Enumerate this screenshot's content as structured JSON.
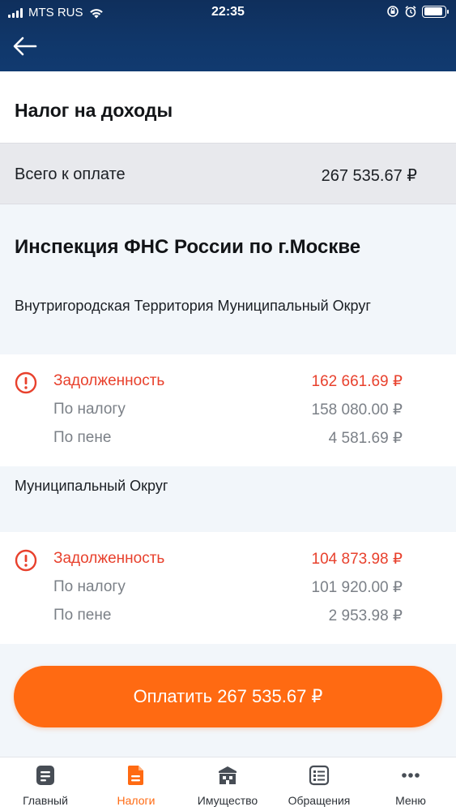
{
  "status_bar": {
    "carrier": "MTS RUS",
    "time": "22:35"
  },
  "header": {
    "back_icon": "arrow-left-icon"
  },
  "page": {
    "title": "Налог на доходы"
  },
  "total": {
    "label": "Всего к оплате",
    "value": "267 535.67 ₽"
  },
  "inspection": {
    "name": "Инспекция ФНС России по г.Москве",
    "district": "Внутригородская Территория Муниципальный Округ"
  },
  "debts": [
    {
      "title": "Задолженность",
      "amount": "162 661.69 ₽",
      "tax_label": "По налогу",
      "tax_amount": "158 080.00 ₽",
      "penalty_label": "По пене",
      "penalty_amount": "4 581.69 ₽"
    },
    {
      "title": "Задолженность",
      "amount": "104 873.98 ₽",
      "tax_label": "По налогу",
      "tax_amount": "101 920.00 ₽",
      "penalty_label": "По пене",
      "penalty_amount": "2 953.98 ₽"
    }
  ],
  "municipality": {
    "label": "Муниципальный Округ"
  },
  "pay_button": {
    "label": "Оплатить 267 535.67 ₽"
  },
  "tabs": [
    {
      "label": "Главный",
      "icon": "document-icon"
    },
    {
      "label": "Налоги",
      "icon": "tax-document-icon",
      "active": true
    },
    {
      "label": "Имущество",
      "icon": "building-icon"
    },
    {
      "label": "Обращения",
      "icon": "list-icon"
    },
    {
      "label": "Меню",
      "icon": "more-dots-icon"
    }
  ],
  "colors": {
    "header_bg": "#10376a",
    "accent_orange": "#ff6a12",
    "debt_red": "#e8412d",
    "muted_text": "#7b8087"
  }
}
